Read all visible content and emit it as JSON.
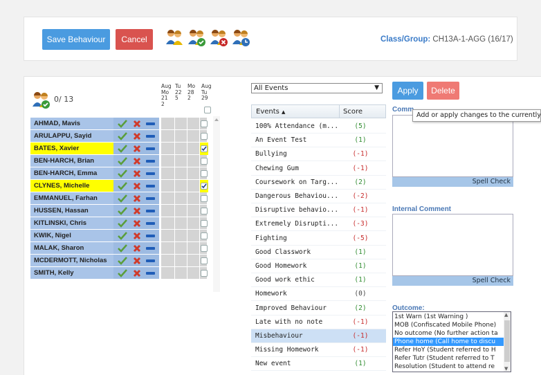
{
  "toolbar": {
    "save_label": "Save Behaviour",
    "cancel_label": "Cancel",
    "class_label": "Class/Group:",
    "class_value": "CH13A-1-AGG (16/17)"
  },
  "summary": {
    "count": "0/ 13"
  },
  "dates": [
    {
      "month": "Aug",
      "day": "Mo",
      "date": "21",
      "num": "2"
    },
    {
      "month": "",
      "day": "Tu",
      "date": "22",
      "num": "5"
    },
    {
      "month": "",
      "day": "Mo",
      "date": "28",
      "num": "2"
    },
    {
      "month": "Aug",
      "day": "Tu",
      "date": "29",
      "num": ""
    }
  ],
  "students": [
    {
      "name": "AHMAD, Mavis",
      "highlight": false,
      "checked": false
    },
    {
      "name": "ARULAPPU, Sayid",
      "highlight": false,
      "checked": false
    },
    {
      "name": "BATES, Xavier",
      "highlight": true,
      "checked": true
    },
    {
      "name": "BEN-HARCH, Brian",
      "highlight": false,
      "checked": false
    },
    {
      "name": "BEN-HARCH, Emma",
      "highlight": false,
      "checked": false
    },
    {
      "name": "CLYNES, Michelle",
      "highlight": true,
      "checked": true
    },
    {
      "name": "EMMANUEL, Farhan",
      "highlight": false,
      "checked": false
    },
    {
      "name": "HUSSEN, Hassan",
      "highlight": false,
      "checked": false
    },
    {
      "name": "KITLINSKI, Chris",
      "highlight": false,
      "checked": false
    },
    {
      "name": "KWIK, Nigel",
      "highlight": false,
      "checked": false
    },
    {
      "name": "MALAK, Sharon",
      "highlight": false,
      "checked": false
    },
    {
      "name": "MCDERMOTT, Nicholas",
      "highlight": false,
      "checked": false
    },
    {
      "name": "SMITH, Kelly",
      "highlight": false,
      "checked": false
    }
  ],
  "events_filter": {
    "selected": "All Events"
  },
  "events_header": {
    "name": "Events",
    "score": "Score"
  },
  "events": [
    {
      "name": "100% Attendance (m...",
      "score": "(5)",
      "sign": "pos",
      "selected": false
    },
    {
      "name": "An Event Test",
      "score": "(1)",
      "sign": "pos",
      "selected": false
    },
    {
      "name": "Bullying",
      "score": "(-1)",
      "sign": "neg",
      "selected": false
    },
    {
      "name": "Chewing Gum",
      "score": "(-1)",
      "sign": "neg",
      "selected": false
    },
    {
      "name": "Coursework on Targ...",
      "score": "(2)",
      "sign": "pos",
      "selected": false
    },
    {
      "name": "Dangerous Behaviou...",
      "score": "(-2)",
      "sign": "neg",
      "selected": false
    },
    {
      "name": "Disruptive behavio...",
      "score": "(-1)",
      "sign": "neg",
      "selected": false
    },
    {
      "name": "Extremely Disrupti...",
      "score": "(-3)",
      "sign": "neg",
      "selected": false
    },
    {
      "name": "Fighting",
      "score": "(-5)",
      "sign": "neg",
      "selected": false
    },
    {
      "name": "Good Classwork",
      "score": "(1)",
      "sign": "pos",
      "selected": false
    },
    {
      "name": "Good Homework",
      "score": "(1)",
      "sign": "pos",
      "selected": false
    },
    {
      "name": "Good work ethic",
      "score": "(1)",
      "sign": "pos",
      "selected": false
    },
    {
      "name": "Homework",
      "score": "(0)",
      "sign": "zero",
      "selected": false
    },
    {
      "name": "Improved Behaviour",
      "score": "(2)",
      "sign": "pos",
      "selected": false
    },
    {
      "name": "Late with no note",
      "score": "(-1)",
      "sign": "neg",
      "selected": false
    },
    {
      "name": "Misbehaviour",
      "score": "(-1)",
      "sign": "neg",
      "selected": true
    },
    {
      "name": "Missing Homework",
      "score": "(-1)",
      "sign": "neg",
      "selected": false
    },
    {
      "name": "New event",
      "score": "(1)",
      "sign": "pos",
      "selected": false
    }
  ],
  "actions": {
    "apply_label": "Apply",
    "delete_label": "Delete"
  },
  "comment": {
    "label": "Comm",
    "tooltip": "Add or apply changes to the currently s",
    "spell": "Spell Check"
  },
  "internal_comment": {
    "label": "Internal Comment",
    "spell": "Spell Check"
  },
  "outcome": {
    "label": "Outcome:",
    "options": [
      "1st Warn (1st Warning )",
      "MOB (Confiscated Mobile Phone)",
      "No outcome (No further action ta",
      "Phone home (Call home to discu",
      "Refer HoY (Student referred to H",
      "Refer Tutr (Student referred to T",
      "Resolution (Student to attend re"
    ],
    "selected_index": 3
  },
  "colors": {
    "primary": "#4a9be0",
    "danger": "#d9534f",
    "row_blue": "#a9c4e8",
    "row_yellow": "#ffff00",
    "cell_gray": "#d4d4d4",
    "selected_row": "#cde0f5"
  }
}
